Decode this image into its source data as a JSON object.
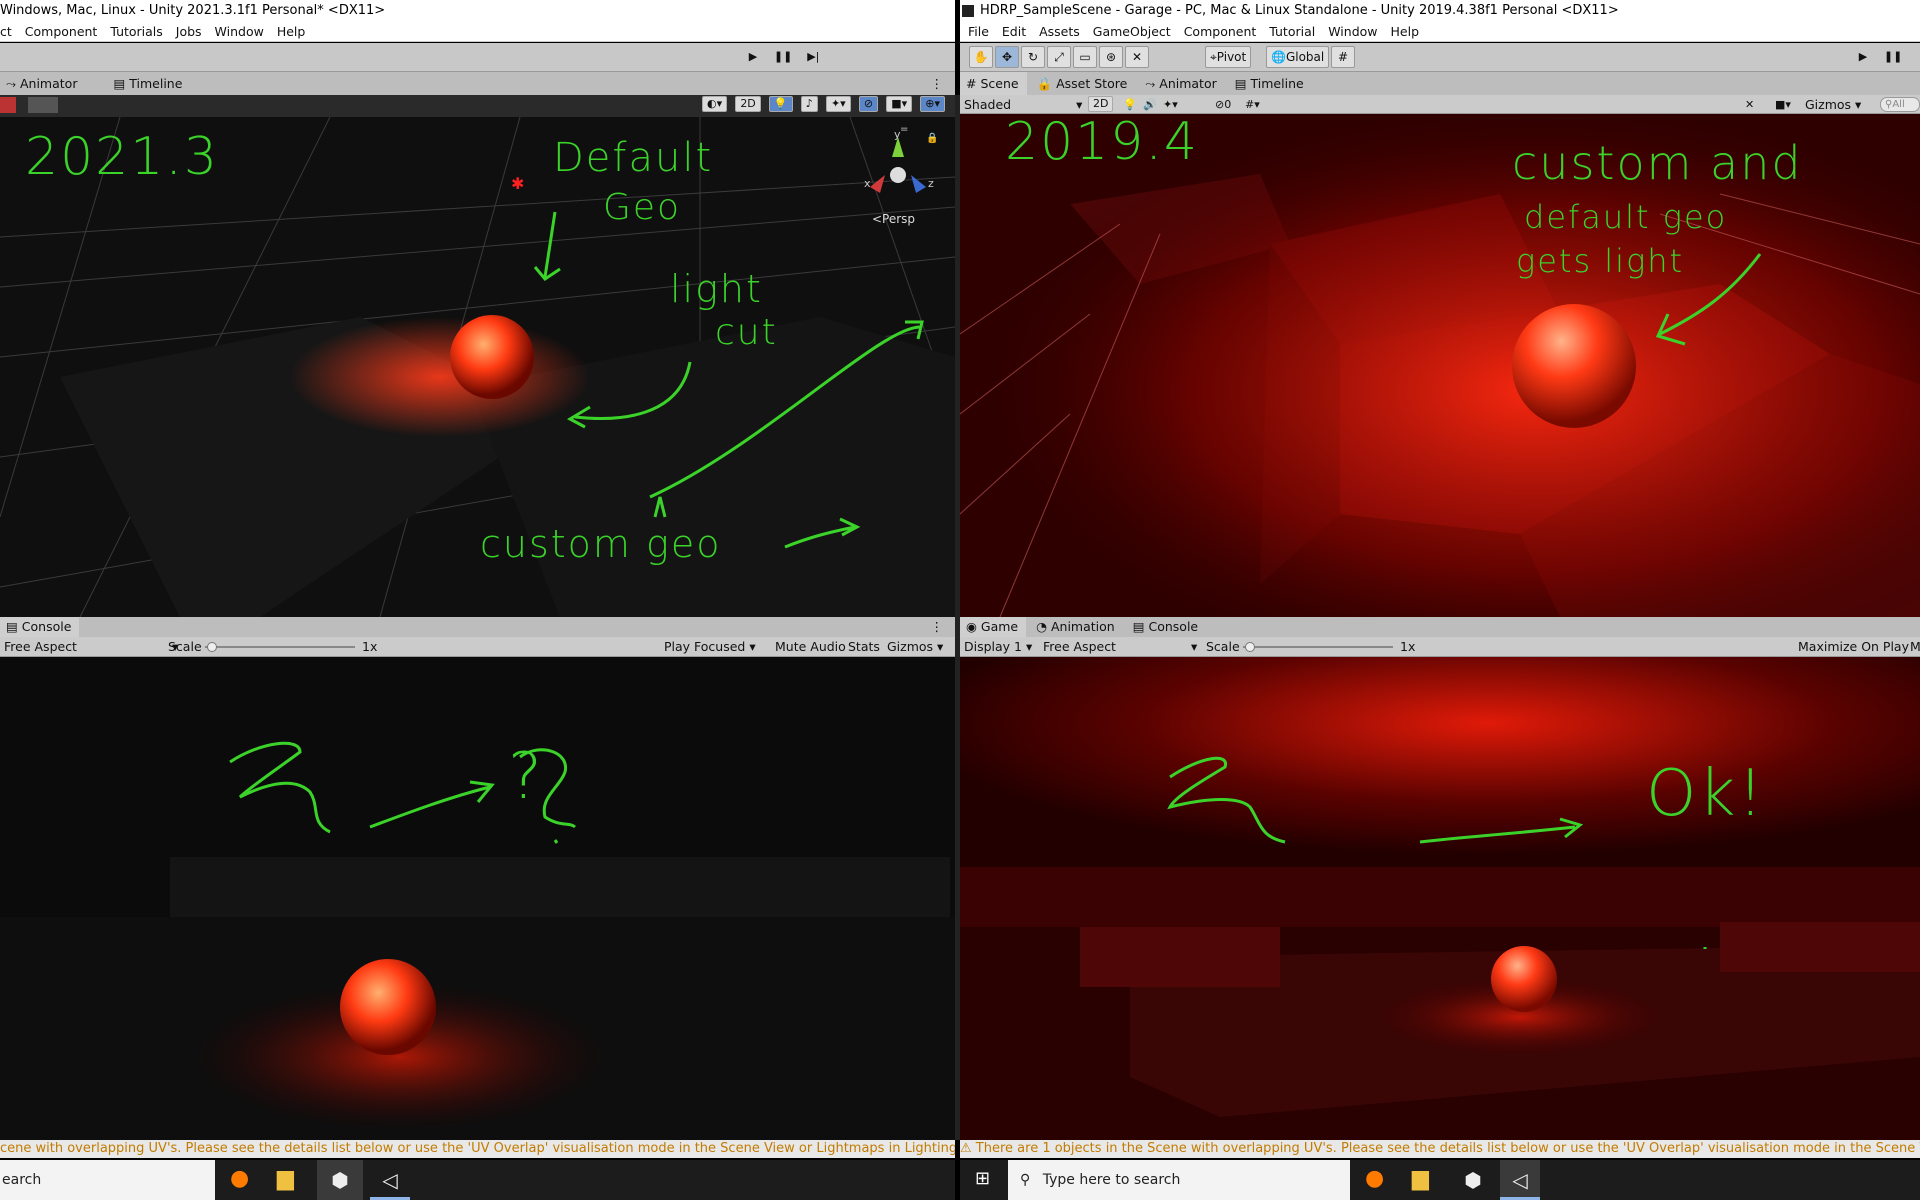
{
  "left": {
    "title": "Windows, Mac, Linux - Unity 2021.3.1f1 Personal* <DX11>",
    "menu": [
      "ct",
      "Component",
      "Tutorials",
      "Jobs",
      "Window",
      "Help"
    ],
    "scene_tabs": [
      {
        "icon": "animator-icon",
        "label": "Animator"
      },
      {
        "icon": "timeline-icon",
        "label": "Timeline"
      }
    ],
    "scene_toolbar": {
      "mode_2d": "2D"
    },
    "persp_label": "<Persp",
    "gizmo_axes": {
      "y": "y",
      "x": "x",
      "z": "z"
    },
    "scene_notes": {
      "version": "2021.3",
      "default_geo_1": "Default",
      "default_geo_2": "Geo",
      "light_cut_1": "light",
      "light_cut_2": "cut",
      "custom_geo": "custom   geo"
    },
    "console_tab": "Console",
    "game_bar": {
      "aspect": "Free Aspect",
      "scale_label": "Scale",
      "scale_value": "1x",
      "play_focused": "Play Focused",
      "mute": "Mute Audio",
      "stats": "Stats",
      "gizmos": "Gizmos"
    },
    "game_note": "?",
    "status": "cene with overlapping UV's. Please see the details list below or use the 'UV Overlap' visualisation mode in the Scene View or Lightmaps in Lighting Settings for more informat"
  },
  "right": {
    "title": "HDRP_SampleScene - Garage - PC, Mac & Linux Standalone - Unity 2019.4.38f1 Personal <DX11>",
    "menu": [
      "File",
      "Edit",
      "Assets",
      "GameObject",
      "Component",
      "Tutorial",
      "Window",
      "Help"
    ],
    "toolbar": {
      "pivot": "Pivot",
      "global": "Global"
    },
    "scene_tabs": [
      {
        "icon": "scene-icon",
        "label": "Scene"
      },
      {
        "icon": "asset-store-icon",
        "label": "Asset Store"
      },
      {
        "icon": "animator-icon",
        "label": "Animator"
      },
      {
        "icon": "timeline-icon",
        "label": "Timeline"
      }
    ],
    "scene_bar": {
      "shading": "Shaded",
      "mode_2d": "2D",
      "hidden_count": "0",
      "gizmos": "Gizmos",
      "search": "All"
    },
    "scene_notes": {
      "version": "2019.4",
      "line1": "custom  and",
      "line2": "default geo",
      "line3": "gets light"
    },
    "game_tabs": [
      {
        "icon": "game-icon",
        "label": "Game"
      },
      {
        "icon": "animation-icon",
        "label": "Animation"
      },
      {
        "icon": "console-icon",
        "label": "Console"
      }
    ],
    "game_bar": {
      "display": "Display 1",
      "aspect": "Free Aspect",
      "scale_label": "Scale",
      "scale_value": "1x",
      "maximize": "Maximize On Play",
      "cut": "M"
    },
    "game_note": "Ok!",
    "status": "There are 1 objects in the Scene with overlapping UV's. Please see the details list below or use the 'UV Overlap' visualisation mode in the Scene View or Lightmaps in Lig"
  },
  "taskbar": {
    "left_search": "earch",
    "right_search": "Type here to search",
    "apps": [
      "firefox-icon",
      "file-explorer-icon",
      "unity-hub-icon",
      "unity-icon"
    ]
  },
  "colors": {
    "annotation": "#3bd32a",
    "warning": "#c27b00",
    "light": "#ff3b1a"
  }
}
